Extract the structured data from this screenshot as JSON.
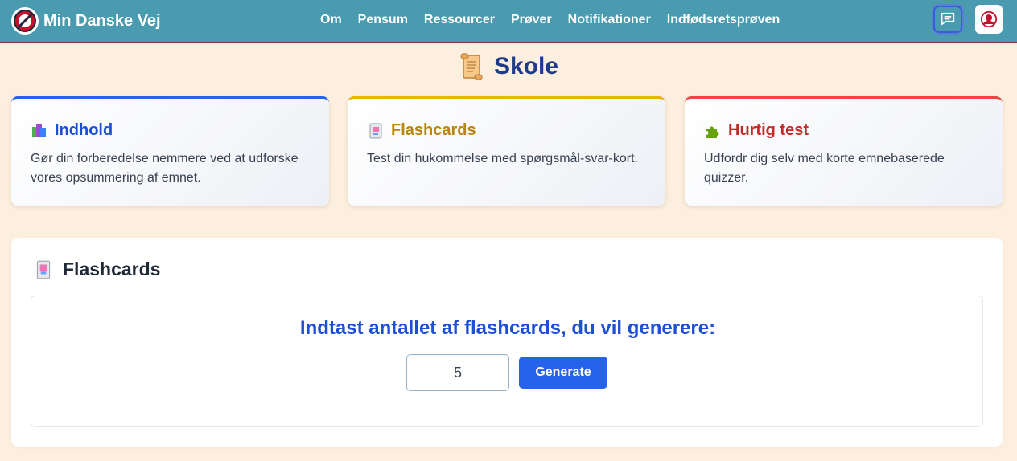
{
  "navbar": {
    "brand": "Min Danske Vej",
    "links": [
      "Om",
      "Pensum",
      "Ressourcer",
      "Prøver",
      "Notifikationer",
      "Indfødsretsprøven"
    ],
    "colors": {
      "background": "#4a9bb0",
      "text": "#ffffff"
    }
  },
  "page": {
    "title": "Skole",
    "title_icon": "scroll-icon"
  },
  "cards": [
    {
      "title": "Indhold",
      "icon": "books-icon",
      "accent": "#2563eb",
      "title_color": "#1d4ed8",
      "description": "Gør din forberedelse nemmere ved at udforske vores opsummering af emnet."
    },
    {
      "title": "Flashcards",
      "icon": "flashcard-icon",
      "accent": "#eab308",
      "title_color": "#b7860b",
      "description": "Test din hukommelse med spørgsmål-svar-kort."
    },
    {
      "title": "Hurtig test",
      "icon": "puzzle-icon",
      "accent": "#ef4444",
      "title_color": "#c62828",
      "description": "Udfordr dig selv med korte emnebaserede quizzer."
    }
  ],
  "flashcards_section": {
    "title": "Flashcards",
    "prompt": "Indtast antallet af flashcards, du vil generere:",
    "count_value": "5",
    "generate_label": "Generate"
  }
}
